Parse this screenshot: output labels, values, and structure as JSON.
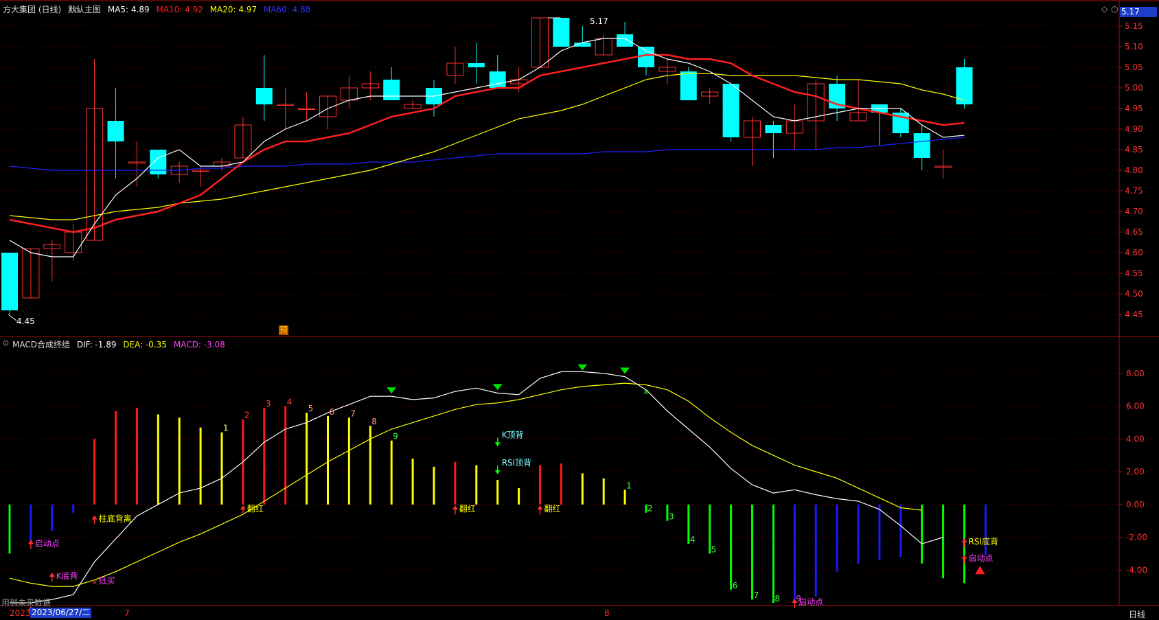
{
  "header": {
    "title": "方大集团 (日线)",
    "main_chart_menu": "默认主图",
    "ma5": "MA5: 4.89",
    "ma10": "MA10: 4.92",
    "ma20": "MA20: 4.97",
    "ma60": "MA60: 4.88"
  },
  "macd_header": {
    "title": "MACD合成终结",
    "dif": "DIF: -1.89",
    "dea": "DEA: -0.35",
    "macd": "MACD: -3.08"
  },
  "price_tag": "5.17",
  "max_label": "5.17",
  "min_label": "4.45",
  "yu_badge": "预",
  "footer": {
    "left_text": "用到未来数据",
    "year": "2023",
    "date": "2023/06/27/二",
    "month7": "7",
    "month8": "8",
    "period": "日线"
  },
  "colors": {
    "ma5": "#ffffff",
    "ma10": "#ff2020",
    "ma20": "#ffff00",
    "ma60": "#2020ff",
    "up": "#ff3232",
    "down": "#00ffff",
    "dif": "#ffffff",
    "dea": "#ffff00"
  },
  "chart_data": [
    {
      "type": "candlestick",
      "ylim": [
        4.4,
        5.2
      ],
      "yticks": [
        "5.15",
        "5.10",
        "5.05",
        "5.00",
        "4.95",
        "4.90",
        "4.85",
        "4.80",
        "4.75",
        "4.70",
        "4.65",
        "4.60",
        "4.55",
        "4.50",
        "4.45"
      ],
      "ohlc": [
        [
          4.6,
          4.6,
          4.45,
          4.46
        ],
        [
          4.49,
          4.61,
          4.49,
          4.61
        ],
        [
          4.61,
          4.63,
          4.53,
          4.62
        ],
        [
          4.6,
          4.67,
          4.58,
          4.65
        ],
        [
          4.63,
          5.07,
          4.63,
          4.95
        ],
        [
          4.92,
          5.0,
          4.78,
          4.87
        ],
        [
          4.82,
          4.87,
          4.76,
          4.82
        ],
        [
          4.85,
          4.85,
          4.78,
          4.79
        ],
        [
          4.79,
          4.82,
          4.77,
          4.81
        ],
        [
          4.8,
          4.81,
          4.76,
          4.8
        ],
        [
          4.81,
          4.83,
          4.8,
          4.82
        ],
        [
          4.83,
          4.93,
          4.83,
          4.91
        ],
        [
          5.0,
          5.08,
          4.92,
          4.96
        ],
        [
          4.96,
          5.0,
          4.9,
          4.96
        ],
        [
          4.95,
          4.99,
          4.92,
          4.95
        ],
        [
          4.93,
          4.98,
          4.9,
          4.98
        ],
        [
          4.97,
          5.03,
          4.95,
          5.0
        ],
        [
          5.0,
          5.04,
          4.97,
          5.01
        ],
        [
          5.02,
          5.05,
          4.97,
          4.97
        ],
        [
          4.95,
          4.97,
          4.95,
          4.96
        ],
        [
          5.0,
          5.02,
          4.93,
          4.96
        ],
        [
          5.03,
          5.1,
          5.01,
          5.06
        ],
        [
          5.06,
          5.11,
          5.01,
          5.05
        ],
        [
          5.04,
          5.08,
          5.0,
          5.0
        ],
        [
          5.01,
          5.05,
          4.99,
          5.02
        ],
        [
          5.05,
          5.17,
          5.05,
          5.17
        ],
        [
          5.17,
          5.11,
          5.11,
          5.1
        ],
        [
          5.11,
          5.15,
          5.1,
          5.1
        ],
        [
          5.08,
          5.13,
          5.08,
          5.12
        ],
        [
          5.13,
          5.16,
          5.11,
          5.1
        ],
        [
          5.1,
          5.1,
          5.03,
          5.05
        ],
        [
          5.04,
          5.07,
          5.01,
          5.05
        ],
        [
          5.04,
          5.05,
          4.98,
          4.97
        ],
        [
          4.98,
          5.0,
          4.96,
          4.99
        ],
        [
          5.01,
          5.01,
          4.87,
          4.88
        ],
        [
          4.88,
          4.93,
          4.81,
          4.92
        ],
        [
          4.91,
          4.92,
          4.83,
          4.89
        ],
        [
          4.89,
          4.96,
          4.85,
          4.92
        ],
        [
          4.92,
          5.02,
          4.85,
          5.01
        ],
        [
          5.01,
          5.03,
          4.92,
          4.95
        ],
        [
          4.92,
          5.02,
          4.92,
          4.94
        ],
        [
          4.96,
          4.96,
          4.86,
          4.94
        ],
        [
          4.94,
          4.95,
          4.88,
          4.89
        ],
        [
          4.89,
          4.91,
          4.8,
          4.83
        ],
        [
          4.81,
          4.85,
          4.78,
          4.81
        ],
        [
          5.05,
          5.07,
          4.95,
          4.96
        ]
      ],
      "ma5": [
        4.63,
        4.6,
        4.59,
        4.59,
        4.67,
        4.74,
        4.78,
        4.83,
        4.85,
        4.81,
        4.81,
        4.82,
        4.87,
        4.9,
        4.92,
        4.95,
        4.97,
        4.98,
        4.98,
        4.98,
        4.98,
        4.99,
        5.0,
        5.01,
        5.02,
        5.05,
        5.09,
        5.11,
        5.12,
        5.12,
        5.09,
        5.07,
        5.06,
        5.04,
        5.01,
        4.97,
        4.93,
        4.92,
        4.93,
        4.94,
        4.95,
        4.95,
        4.95,
        4.91,
        4.88,
        4.885
      ],
      "ma10": [
        4.68,
        4.67,
        4.66,
        4.65,
        4.66,
        4.68,
        4.69,
        4.7,
        4.72,
        4.74,
        4.78,
        4.82,
        4.85,
        4.87,
        4.87,
        4.88,
        4.89,
        4.91,
        4.93,
        4.94,
        4.95,
        4.98,
        4.99,
        5.0,
        5.0,
        5.03,
        5.04,
        5.05,
        5.06,
        5.07,
        5.08,
        5.08,
        5.07,
        5.07,
        5.06,
        5.03,
        5.01,
        4.99,
        4.98,
        4.96,
        4.95,
        4.94,
        4.93,
        4.92,
        4.91,
        4.915
      ],
      "ma20": [
        4.69,
        4.685,
        4.68,
        4.68,
        4.69,
        4.7,
        4.705,
        4.71,
        4.72,
        4.725,
        4.73,
        4.74,
        4.75,
        4.76,
        4.77,
        4.78,
        4.79,
        4.8,
        4.815,
        4.83,
        4.845,
        4.865,
        4.885,
        4.905,
        4.925,
        4.935,
        4.945,
        4.96,
        4.98,
        5.0,
        5.02,
        5.03,
        5.035,
        5.035,
        5.03,
        5.03,
        5.03,
        5.03,
        5.025,
        5.02,
        5.02,
        5.015,
        5.01,
        4.995,
        4.985,
        4.97
      ],
      "ma60": [
        4.81,
        4.805,
        4.8,
        4.8,
        4.8,
        4.8,
        4.8,
        4.8,
        4.8,
        4.805,
        4.805,
        4.81,
        4.81,
        4.81,
        4.815,
        4.815,
        4.815,
        4.82,
        4.82,
        4.82,
        4.825,
        4.83,
        4.835,
        4.84,
        4.84,
        4.84,
        4.84,
        4.84,
        4.845,
        4.845,
        4.845,
        4.85,
        4.85,
        4.85,
        4.85,
        4.85,
        4.85,
        4.85,
        4.85,
        4.855,
        4.855,
        4.86,
        4.865,
        4.87,
        4.875,
        4.88
      ]
    },
    {
      "type": "macd",
      "ylim": [
        -6.0,
        9.5
      ],
      "yticks": [
        "8.00",
        "6.00",
        "4.00",
        "2.00",
        "0.00",
        "-2.00",
        "-4.00"
      ],
      "dif": [
        -6.0,
        -6.0,
        -5.8,
        -5.5,
        -3.5,
        -2.1,
        -0.7,
        0.0,
        0.7,
        1.0,
        1.6,
        2.6,
        3.8,
        4.6,
        5.0,
        5.6,
        6.1,
        6.6,
        6.6,
        6.4,
        6.5,
        6.9,
        7.1,
        6.8,
        6.7,
        7.7,
        8.1,
        8.1,
        8.0,
        7.8,
        7.0,
        5.7,
        4.6,
        3.5,
        2.2,
        1.2,
        0.7,
        0.9,
        0.6,
        0.35,
        0.2,
        -0.3,
        -1.3,
        -2.4,
        -2.0
      ],
      "dea": [
        -4.5,
        -4.8,
        -5.0,
        -5.0,
        -4.6,
        -4.1,
        -3.5,
        -2.9,
        -2.3,
        -1.8,
        -1.2,
        -0.6,
        0.2,
        1.0,
        1.8,
        2.6,
        3.3,
        4.0,
        4.6,
        5.0,
        5.4,
        5.8,
        6.1,
        6.2,
        6.4,
        6.7,
        7.0,
        7.2,
        7.3,
        7.4,
        7.3,
        7.0,
        6.3,
        5.3,
        4.4,
        3.6,
        3.0,
        2.4,
        2.0,
        1.6,
        1.0,
        0.4,
        -0.2,
        -0.35
      ],
      "macd": [
        -3.0,
        -2.3,
        -1.6,
        -0.5,
        4.0,
        5.7,
        5.9,
        5.5,
        5.3,
        4.7,
        4.4,
        5.2,
        5.9,
        6.0,
        5.6,
        5.4,
        5.3,
        4.8,
        3.9,
        2.8,
        2.3,
        2.6,
        2.4,
        1.5,
        1.0,
        2.4,
        2.5,
        1.9,
        1.6,
        0.9,
        -0.5,
        -1.0,
        -2.4,
        -3.0,
        -5.2,
        -5.8,
        -6.0,
        -6.0,
        -5.6,
        -4.1,
        -3.6,
        -3.4,
        -3.2,
        -3.6,
        -4.5,
        -4.8,
        -3.08
      ],
      "macd_colors": [
        "green",
        "blue",
        "blue",
        "blue",
        "red",
        "red",
        "red",
        "yellow",
        "yellow",
        "yellow",
        "yellow",
        "red",
        "red",
        "red",
        "yellow",
        "yellow",
        "yellow",
        "yellow",
        "yellow",
        "yellow",
        "yellow",
        "red",
        "yellow",
        "yellow",
        "yellow",
        "red",
        "red",
        "yellow",
        "yellow",
        "yellow",
        "green",
        "green",
        "green",
        "green",
        "green",
        "green",
        "green",
        "blue",
        "blue",
        "blue",
        "blue",
        "blue",
        "blue",
        "green",
        "green",
        "green",
        "blue"
      ],
      "count_labels": [
        {
          "i": 10,
          "v": 4.4,
          "t": "1",
          "c": "#ffff80"
        },
        {
          "i": 11,
          "v": 5.2,
          "t": "2",
          "c": "#ff4040"
        },
        {
          "i": 12,
          "v": 5.9,
          "t": "3",
          "c": "#ff4040"
        },
        {
          "i": 13,
          "v": 6.0,
          "t": "4",
          "c": "#ff4040"
        },
        {
          "i": 14,
          "v": 5.6,
          "t": "5",
          "c": "#ffa080"
        },
        {
          "i": 15,
          "v": 5.4,
          "t": "6",
          "c": "#ffa080"
        },
        {
          "i": 16,
          "v": 5.3,
          "t": "7",
          "c": "#ffa080"
        },
        {
          "i": 17,
          "v": 4.8,
          "t": "8",
          "c": "#ffa080"
        },
        {
          "i": 18,
          "v": 3.9,
          "t": "9",
          "c": "#40ff40"
        },
        {
          "i": 29,
          "v": 0.9,
          "t": "1",
          "c": "#40ff40"
        },
        {
          "i": 30,
          "v": -0.5,
          "t": "2",
          "c": "#40ff40"
        },
        {
          "i": 31,
          "v": -1.0,
          "t": "3",
          "c": "#40ff40"
        },
        {
          "i": 32,
          "v": -2.4,
          "t": "4",
          "c": "#40ff40"
        },
        {
          "i": 33,
          "v": -3.0,
          "t": "5",
          "c": "#40ff40"
        },
        {
          "i": 34,
          "v": -5.2,
          "t": "6",
          "c": "#40ff40"
        },
        {
          "i": 35,
          "v": -5.8,
          "t": "7",
          "c": "#40ff40"
        },
        {
          "i": 36,
          "v": -6.0,
          "t": "8",
          "c": "#40ff40"
        },
        {
          "i": 37,
          "v": -6.0,
          "t": "9",
          "c": "#ff40ff"
        }
      ],
      "annotations": [
        {
          "i": 1,
          "v": -2.2,
          "t": "启动点",
          "c": "#ff40ff",
          "arrow": "up"
        },
        {
          "i": 2,
          "v": -4.2,
          "t": "K底背",
          "c": "#ff40ff",
          "arrow": "up"
        },
        {
          "i": 4,
          "v": -0.7,
          "t": "柱底背离",
          "c": "#ffff00",
          "arrow": "up"
        },
        {
          "i": 4,
          "v": -4.5,
          "t": "低买",
          "c": "#ff40ff",
          "arrow": "x"
        },
        {
          "i": 11,
          "v": -0.1,
          "t": "翻红",
          "c": "#ffff00",
          "arrow": "up"
        },
        {
          "i": 21,
          "v": -0.1,
          "t": "翻红",
          "c": "#ffff00",
          "arrow": "up"
        },
        {
          "i": 25,
          "v": -0.1,
          "t": "翻红",
          "c": "#ffff00",
          "arrow": "up"
        },
        {
          "i": 23,
          "v": 4.0,
          "t": "K顶背",
          "c": "#80ffff",
          "arrow": "down"
        },
        {
          "i": 23,
          "v": 2.3,
          "t": "RSI顶背",
          "c": "#80ffff",
          "arrow": "down"
        },
        {
          "i": 37,
          "v": -5.8,
          "t": "启动点",
          "c": "#ff40ff",
          "arrow": "up"
        },
        {
          "i": 45,
          "v": -2.1,
          "t": "RSI底背",
          "c": "#ffff00",
          "arrow": "up"
        },
        {
          "i": 45,
          "v": -3.1,
          "t": "启动点",
          "c": "#ff40ff",
          "arrow": "up"
        }
      ],
      "down_markers": [
        {
          "i": 18,
          "v": 6.9
        },
        {
          "i": 23,
          "v": 7.1
        },
        {
          "i": 27,
          "v": 8.3
        },
        {
          "i": 29,
          "v": 8.1
        }
      ],
      "x_markers": [
        {
          "i": 30,
          "v": 6.9
        }
      ]
    }
  ]
}
